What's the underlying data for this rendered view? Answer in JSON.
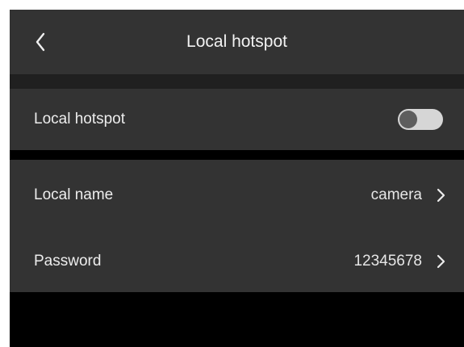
{
  "header": {
    "title": "Local hotspot"
  },
  "hotspot": {
    "label": "Local hotspot",
    "enabled": false
  },
  "settings": {
    "name_label": "Local name",
    "name_value": "camera",
    "password_label": "Password",
    "password_value": "12345678"
  },
  "icons": {
    "back": "chevron-left-icon",
    "next": "chevron-right-icon"
  },
  "colors": {
    "bar": "#333333",
    "background": "#000000",
    "text": "#ededed",
    "toggle_track": "#d6d6d6",
    "toggle_knob": "#5e5e5e"
  }
}
